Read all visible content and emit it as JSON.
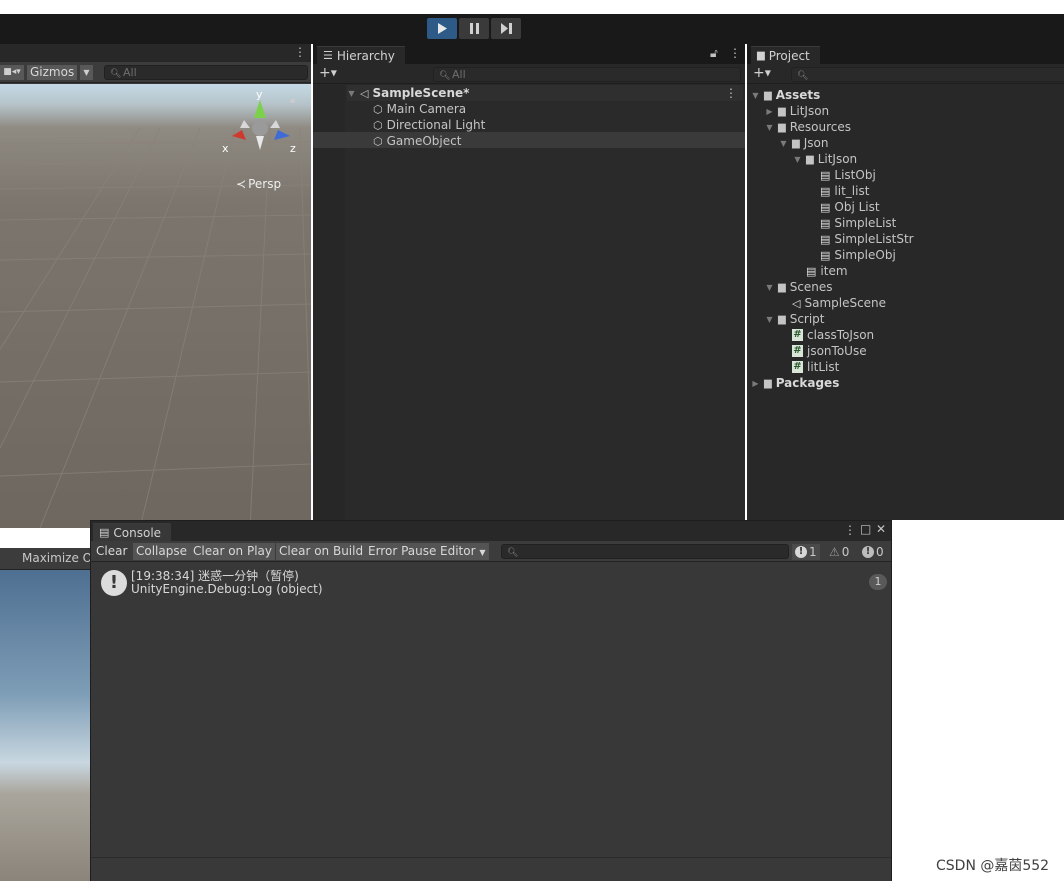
{
  "toolbar": {
    "play_icon": "play-icon",
    "pause_icon": "pause-icon",
    "step_icon": "step-icon"
  },
  "scene": {
    "gizmos_label": "Gizmos",
    "search_placeholder": "All",
    "axis_x": "x",
    "axis_y": "y",
    "axis_z": "z",
    "persp_label": "Persp"
  },
  "game": {
    "maximize_label": "Maximize On"
  },
  "hierarchy": {
    "tab_label": "Hierarchy",
    "search_placeholder": "All",
    "scene_name": "SampleScene*",
    "items": [
      "Main Camera",
      "Directional Light",
      "GameObject"
    ]
  },
  "project": {
    "tab_label": "Project",
    "tree": [
      {
        "label": "Assets",
        "depth": 0,
        "expanded": true,
        "kind": "folder",
        "bold": true
      },
      {
        "label": "LitJson",
        "depth": 1,
        "expanded": false,
        "kind": "folder"
      },
      {
        "label": "Resources",
        "depth": 1,
        "expanded": true,
        "kind": "folder"
      },
      {
        "label": "Json",
        "depth": 2,
        "expanded": true,
        "kind": "folder"
      },
      {
        "label": "LitJson",
        "depth": 3,
        "expanded": true,
        "kind": "folder"
      },
      {
        "label": "ListObj",
        "depth": 4,
        "kind": "file"
      },
      {
        "label": "lit_list",
        "depth": 4,
        "kind": "file"
      },
      {
        "label": "Obj List",
        "depth": 4,
        "kind": "file"
      },
      {
        "label": "SimpleList",
        "depth": 4,
        "kind": "file"
      },
      {
        "label": "SimpleListStr",
        "depth": 4,
        "kind": "file"
      },
      {
        "label": "SimpleObj",
        "depth": 4,
        "kind": "file"
      },
      {
        "label": "item",
        "depth": 3,
        "kind": "file"
      },
      {
        "label": "Scenes",
        "depth": 1,
        "expanded": true,
        "kind": "folder"
      },
      {
        "label": "SampleScene",
        "depth": 2,
        "kind": "scene"
      },
      {
        "label": "Script",
        "depth": 1,
        "expanded": true,
        "kind": "folder"
      },
      {
        "label": "classToJson",
        "depth": 2,
        "kind": "script"
      },
      {
        "label": "jsonToUse",
        "depth": 2,
        "kind": "script"
      },
      {
        "label": "litList",
        "depth": 2,
        "kind": "script"
      },
      {
        "label": "Packages",
        "depth": 0,
        "expanded": false,
        "kind": "folder",
        "bold": true
      }
    ]
  },
  "console": {
    "tab_label": "Console",
    "buttons": [
      "Clear",
      "Collapse",
      "Clear on Play",
      "Clear on Build",
      "Error Pause",
      "Editor"
    ],
    "counts": {
      "log": "1",
      "warning": "0",
      "error": "0"
    },
    "entry": {
      "line1": "[19:38:34] 迷惑一分钟（暂停)",
      "line2": "UnityEngine.Debug:Log (object)",
      "count": "1"
    }
  },
  "watermark": "CSDN @嘉茵552",
  "colors": {
    "play_active": "#2d5a86",
    "panel": "#383838",
    "panel_dark": "#282828"
  }
}
